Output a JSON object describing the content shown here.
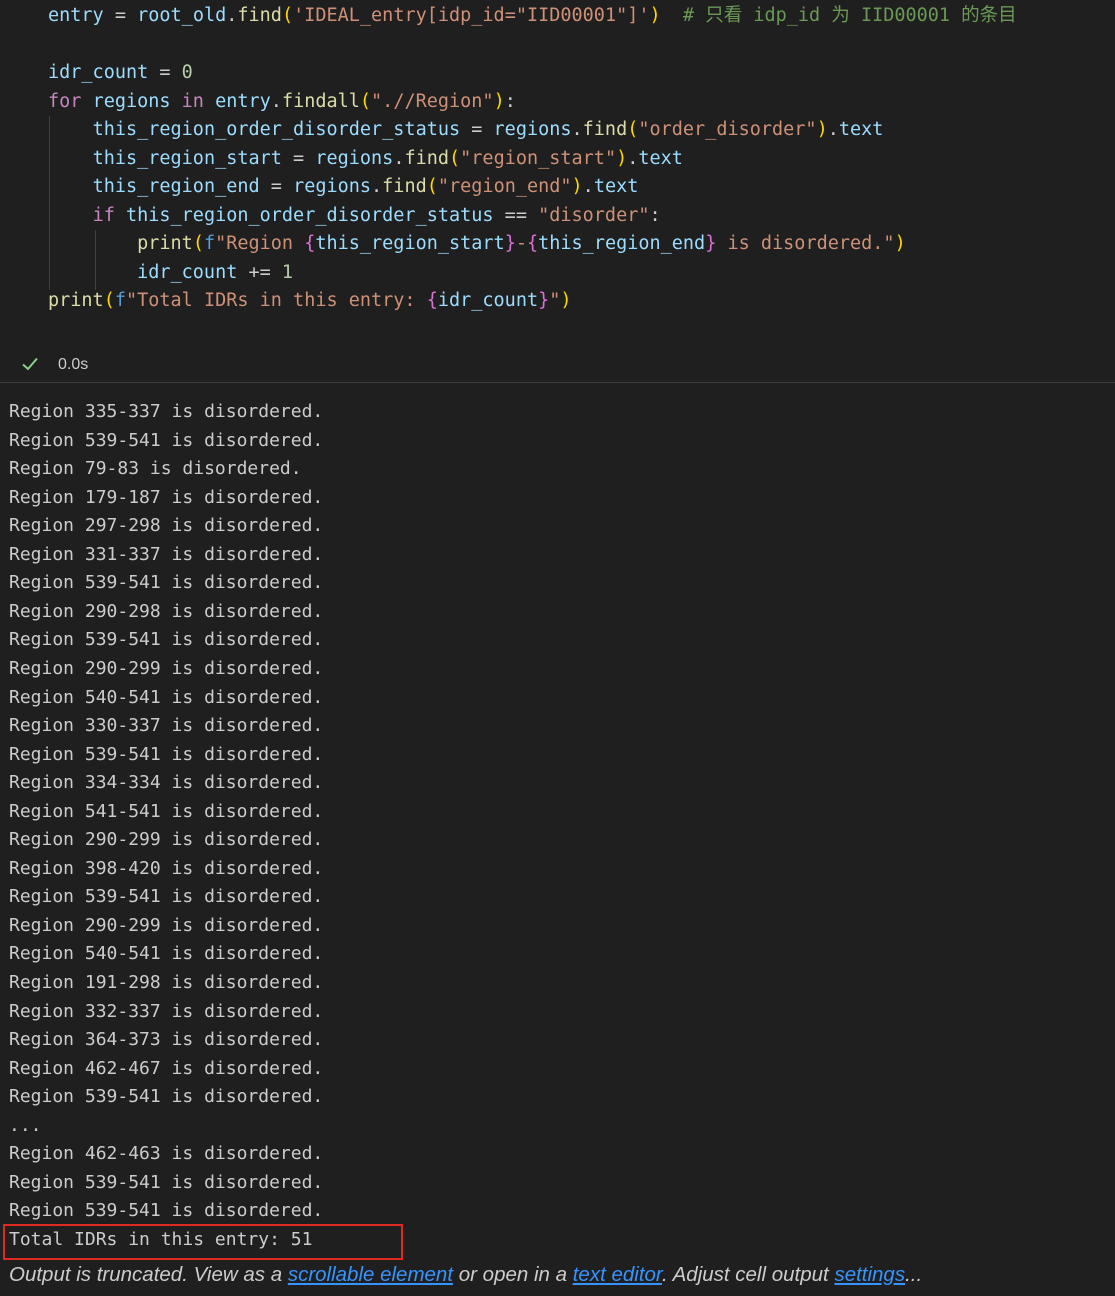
{
  "cell": {
    "code_lines": [
      "entry = root_old.find('IDEAL_entry[idp_id=\"IID00001\"]')  # 只看 idp_id 为 IID00001 的条目",
      "",
      "idr_count = 0",
      "for regions in entry.findall(\".//Region\"):",
      "    this_region_order_disorder_status = regions.find(\"order_disorder\").text",
      "    this_region_start = regions.find(\"region_start\").text",
      "    this_region_end = regions.find(\"region_end\").text",
      "    if this_region_order_disorder_status == \"disorder\":",
      "        print(f\"Region {this_region_start}-{this_region_end} is disordered.\")",
      "        idr_count += 1",
      "print(f\"Total IDRs in this entry: {idr_count}\")"
    ],
    "status": {
      "icon": "check-icon",
      "duration": "0.0s",
      "success_color": "#89d185"
    }
  },
  "output": {
    "lines": [
      "Region 335-337 is disordered.",
      "Region 539-541 is disordered.",
      "Region 79-83 is disordered.",
      "Region 179-187 is disordered.",
      "Region 297-298 is disordered.",
      "Region 331-337 is disordered.",
      "Region 539-541 is disordered.",
      "Region 290-298 is disordered.",
      "Region 539-541 is disordered.",
      "Region 290-299 is disordered.",
      "Region 540-541 is disordered.",
      "Region 330-337 is disordered.",
      "Region 539-541 is disordered.",
      "Region 334-334 is disordered.",
      "Region 541-541 is disordered.",
      "Region 290-299 is disordered.",
      "Region 398-420 is disordered.",
      "Region 539-541 is disordered.",
      "Region 290-299 is disordered.",
      "Region 540-541 is disordered.",
      "Region 191-298 is disordered.",
      "Region 332-337 is disordered.",
      "Region 364-373 is disordered.",
      "Region 462-467 is disordered.",
      "Region 539-541 is disordered.",
      "...",
      "Region 462-463 is disordered.",
      "Region 539-541 is disordered.",
      "Region 539-541 is disordered.",
      "Total IDRs in this entry: 51"
    ],
    "highlight_color": "#e0291f",
    "truncation": {
      "prefix": "Output is truncated. View as a ",
      "link_scrollable": "scrollable element",
      "middle": " or open in a ",
      "link_text_editor": "text editor",
      "suffix": ". Adjust cell output ",
      "link_settings": "settings",
      "ellipsis": "..."
    }
  }
}
